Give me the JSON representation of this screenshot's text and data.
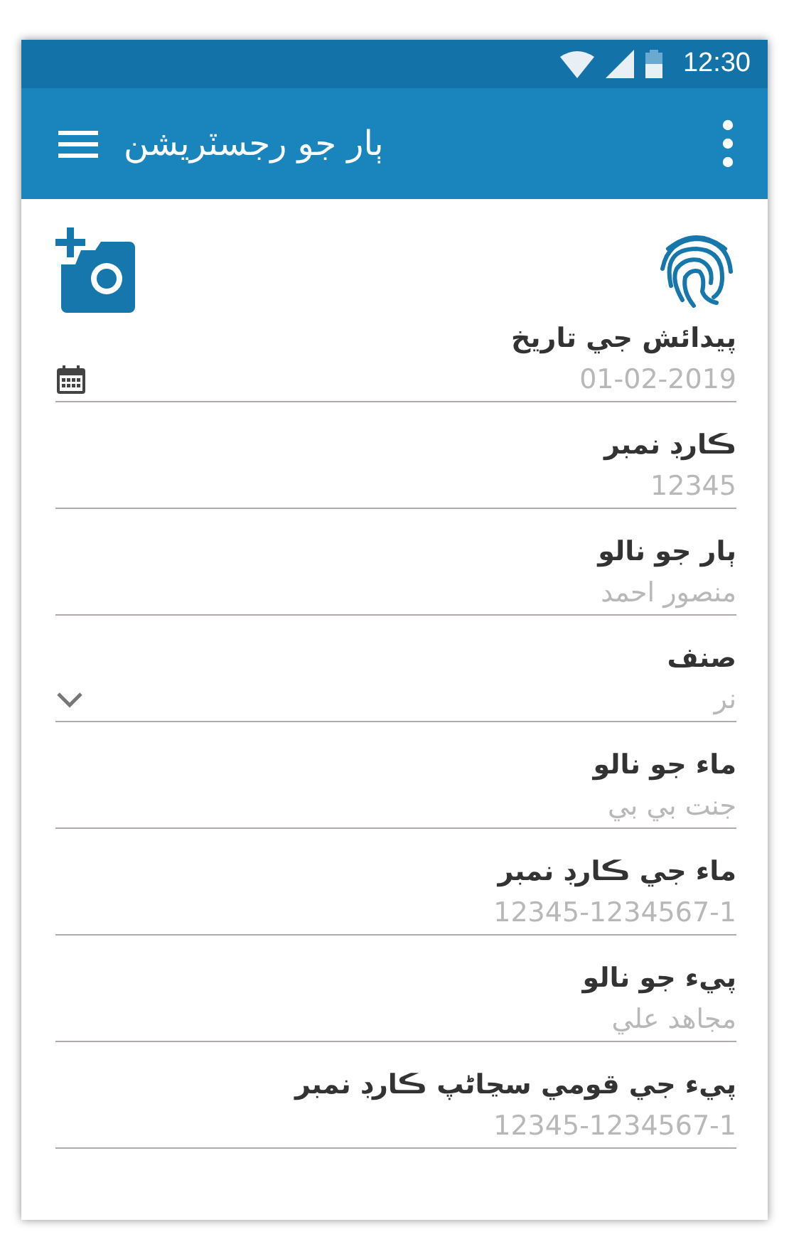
{
  "status_bar": {
    "time": "12:30"
  },
  "app_bar": {
    "title": "ٻار جو رجسٽريشن"
  },
  "fields": [
    {
      "kind": "date",
      "label": "پيدائش جي تاريخ",
      "placeholder": "01-02-2019"
    },
    {
      "kind": "text",
      "label": "ڪارڊ نمبر",
      "placeholder": "12345"
    },
    {
      "kind": "text",
      "label": "ٻار جو نالو",
      "placeholder": "منصور احمد"
    },
    {
      "kind": "select",
      "label": "صنف",
      "placeholder": "نر"
    },
    {
      "kind": "text",
      "label": "ماء جو نالو",
      "placeholder": "جنت بي بي"
    },
    {
      "kind": "text",
      "label": "ماء جي ڪارڊ نمبر",
      "placeholder": "12345-1234567-1"
    },
    {
      "kind": "text",
      "label": "پيء جو نالو",
      "placeholder": "مجاهد علي"
    },
    {
      "kind": "text",
      "label": "پيء جي قومي سڃاڻپ ڪارڊ نمبر",
      "placeholder": "12345-1234567-1"
    }
  ]
}
